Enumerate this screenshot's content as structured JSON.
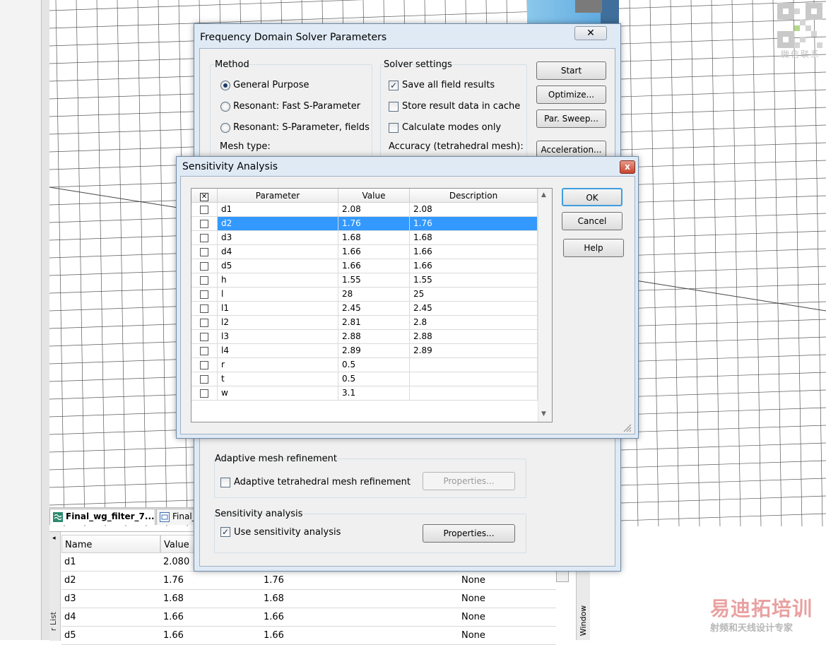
{
  "background": {
    "qr_caption": "微信联系",
    "doc_tabs": [
      {
        "label": "Final_wg_filter_7..."
      },
      {
        "label": "Final_"
      }
    ],
    "param_list": {
      "side_label": "r List",
      "right_label": "Window",
      "columns": [
        "Name",
        "Value"
      ],
      "rows": [
        {
          "name": "d1",
          "value": "2.080",
          "expr": "",
          "type": ""
        },
        {
          "name": "d2",
          "value": "1.76",
          "expr": "1.76",
          "type": "None"
        },
        {
          "name": "d3",
          "value": "1.68",
          "expr": "1.68",
          "type": "None"
        },
        {
          "name": "d4",
          "value": "1.66",
          "expr": "1.66",
          "type": "None"
        },
        {
          "name": "d5",
          "value": "1.66",
          "expr": "1.66",
          "type": "None"
        }
      ]
    },
    "watermark": {
      "big": "易迪拓培训",
      "small": "射频和天线设计专家"
    }
  },
  "solver_dialog": {
    "title": "Frequency Domain Solver Parameters",
    "close": "✕",
    "method": {
      "title": "Method",
      "options": [
        "General Purpose",
        "Resonant: Fast S-Parameter",
        "Resonant: S-Parameter, fields"
      ],
      "selected_index": 0,
      "mesh_type_label": "Mesh type:"
    },
    "solver_settings": {
      "title": "Solver settings",
      "checks": [
        {
          "label": "Save all field results",
          "checked": true
        },
        {
          "label": "Store result data in cache",
          "checked": false
        },
        {
          "label": "Calculate modes only",
          "checked": false
        }
      ],
      "accuracy_label": "Accuracy (tetrahedral mesh):"
    },
    "buttons": [
      "Start",
      "Optimize...",
      "Par. Sweep...",
      "Acceleration..."
    ],
    "adaptive": {
      "title": "Adaptive mesh refinement",
      "check_label": "Adaptive tetrahedral mesh refinement",
      "checked": false,
      "button": "Properties..."
    },
    "sensitivity": {
      "title": "Sensitivity analysis",
      "check_label": "Use sensitivity analysis",
      "checked": true,
      "button": "Properties..."
    }
  },
  "sensitivity_dialog": {
    "title": "Sensitivity Analysis",
    "close": "x",
    "columns": {
      "check": "✕",
      "parameter": "Parameter",
      "value": "Value",
      "description": "Description"
    },
    "rows": [
      {
        "parameter": "d1",
        "value": "2.08",
        "description": "2.08"
      },
      {
        "parameter": "d2",
        "value": "1.76",
        "description": "1.76",
        "selected": true
      },
      {
        "parameter": "d3",
        "value": "1.68",
        "description": "1.68"
      },
      {
        "parameter": "d4",
        "value": "1.66",
        "description": "1.66"
      },
      {
        "parameter": "d5",
        "value": "1.66",
        "description": "1.66"
      },
      {
        "parameter": "h",
        "value": "1.55",
        "description": "1.55"
      },
      {
        "parameter": "l",
        "value": "28",
        "description": "25"
      },
      {
        "parameter": "l1",
        "value": "2.45",
        "description": "2.45"
      },
      {
        "parameter": "l2",
        "value": "2.81",
        "description": "2.8"
      },
      {
        "parameter": "l3",
        "value": "2.88",
        "description": "2.88"
      },
      {
        "parameter": "l4",
        "value": "2.89",
        "description": "2.89"
      },
      {
        "parameter": "r",
        "value": "0.5",
        "description": ""
      },
      {
        "parameter": "t",
        "value": "0.5",
        "description": ""
      },
      {
        "parameter": "w",
        "value": "3.1",
        "description": ""
      }
    ],
    "buttons": {
      "ok": "OK",
      "cancel": "Cancel",
      "help": "Help"
    },
    "scroll_up": "▲",
    "scroll_down": "▼"
  },
  "colors": {
    "selection": "#3399ff",
    "dialog_frame": "#dfeaf5",
    "watermark": "#e9a1a1"
  }
}
